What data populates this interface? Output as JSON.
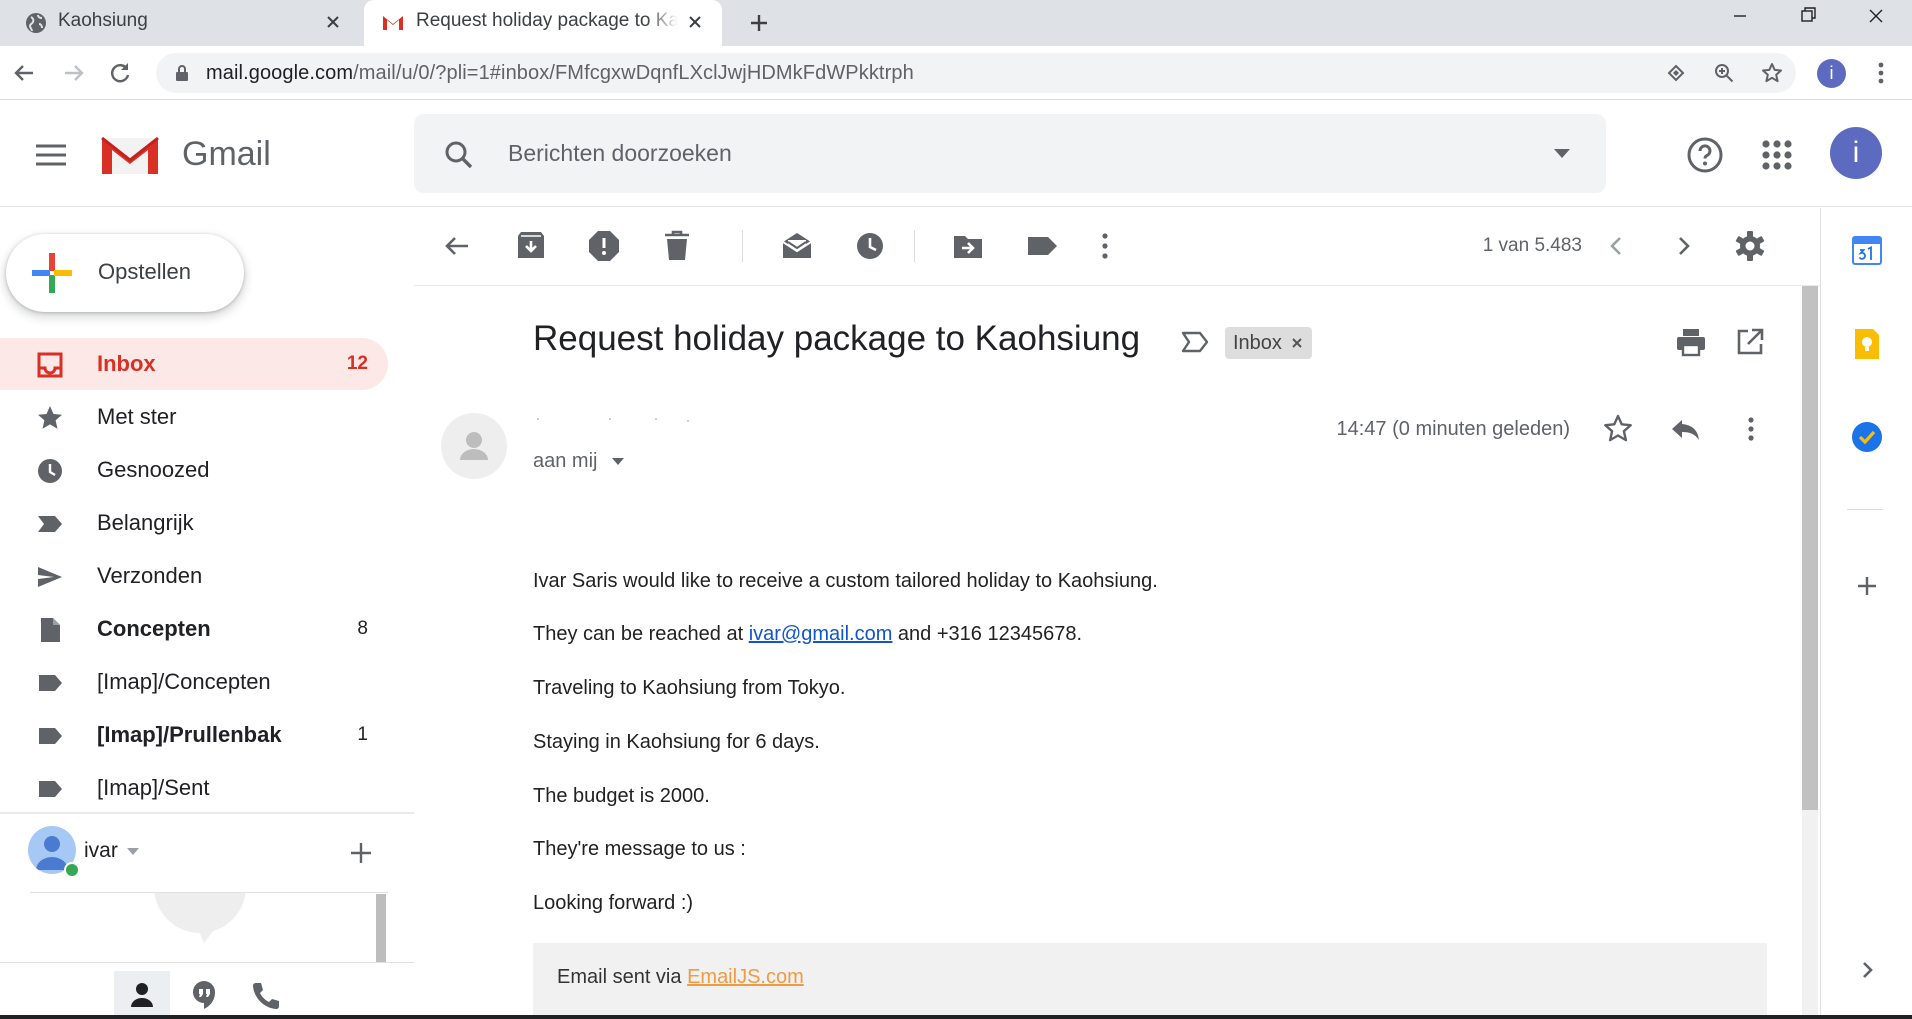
{
  "browser": {
    "tabs": [
      {
        "title": "Kaohsiung",
        "favicon": "globe-icon",
        "active": false
      },
      {
        "title": "Request holiday package to Kaohsiung",
        "favicon": "gmail-icon",
        "active": true
      }
    ],
    "url_host": "mail.google.com",
    "url_path": "/mail/u/0/?pli=1#inbox/FMfcgxwDqnfLXclJwjHDMkFdWPkktrph",
    "profile_initial": "i"
  },
  "gmail": {
    "logo_text": "Gmail",
    "search_placeholder": "Berichten doorzoeken",
    "avatar_initial": "i"
  },
  "nav": {
    "compose_label": "Opstellen",
    "items": [
      {
        "label": "Inbox",
        "count": "12",
        "icon": "inbox-icon"
      },
      {
        "label": "Met ster",
        "count": "",
        "icon": "star-icon"
      },
      {
        "label": "Gesnoozed",
        "count": "",
        "icon": "clock-icon"
      },
      {
        "label": "Belangrijk",
        "count": "",
        "icon": "important-icon"
      },
      {
        "label": "Verzonden",
        "count": "",
        "icon": "send-icon"
      },
      {
        "label": "Concepten",
        "count": "8",
        "icon": "draft-icon"
      },
      {
        "label": "[Imap]/Concepten",
        "count": "",
        "icon": "label-icon"
      },
      {
        "label": "[Imap]/Prullenbak",
        "count": "1",
        "icon": "label-icon"
      },
      {
        "label": "[Imap]/Sent",
        "count": "",
        "icon": "label-icon"
      }
    ]
  },
  "hangouts": {
    "user_name": "ivar"
  },
  "toolbar": {
    "pager_text": "1 van 5.483"
  },
  "message": {
    "subject": "Request holiday package to Kaohsiung",
    "label_chip": "Inbox",
    "recipient": "aan mij",
    "time": "14:47 (0 minuten geleden)",
    "lines": {
      "l1": "Ivar Saris would like to receive a custom tailored holiday to Kaohsiung.",
      "l2_pre": "They can be reached at ",
      "l2_email": "ivar@gmail.com",
      "l2_post": " and +316 12345678.",
      "l3": "Traveling to Kaohsiung from Tokyo.",
      "l4": "Staying in Kaohsiung for 6 days.",
      "l5": "The budget is 2000.",
      "l6": "They're message to us :",
      "l7": "Looking forward :)"
    },
    "footer_pre": "Email sent via ",
    "footer_link": "EmailJS.com"
  },
  "colors": {
    "active_nav_bg": "#fce8e6",
    "active_nav_text": "#d93025",
    "link": "#1155cc",
    "emailjs_link": "#f29a3f",
    "avatar": "#5c6bc0"
  }
}
